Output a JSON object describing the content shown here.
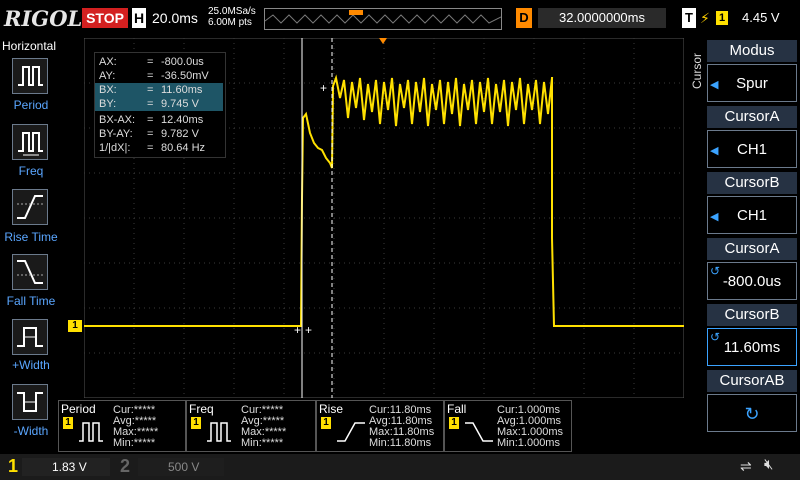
{
  "header": {
    "logo": "RIGOL",
    "run_state": "STOP",
    "h_label": "H",
    "timebase": "20.0ms",
    "sample_rate": "25.0MSa/s",
    "mem_depth": "6.00M pts",
    "d_label": "D",
    "delay": "32.0000000ms",
    "t_label": "T",
    "trigger_slope_icon": "rising-edge-icon",
    "trigger_channel": "1",
    "trigger_level": "4.45 V"
  },
  "left_menu": {
    "title": "Horizontal",
    "items": [
      {
        "label": "Period",
        "icon": "period-measure-icon"
      },
      {
        "label": "Freq",
        "icon": "freq-measure-icon"
      },
      {
        "label": "Rise Time",
        "icon": "rise-time-icon"
      },
      {
        "label": "Fall Time",
        "icon": "fall-time-icon"
      },
      {
        "label": "+Width",
        "icon": "pos-width-icon"
      },
      {
        "label": "-Width",
        "icon": "neg-width-icon"
      }
    ]
  },
  "cursor_readout": [
    {
      "key": "AX:",
      "value": "-800.0us"
    },
    {
      "key": "AY:",
      "value": "-36.50mV"
    },
    {
      "key": "BX:",
      "value": "11.60ms"
    },
    {
      "key": "BY:",
      "value": "9.745 V"
    },
    {
      "key": "BX-AX:",
      "value": "12.40ms"
    },
    {
      "key": "BY-AY:",
      "value": "9.782 V"
    },
    {
      "key": "1/|dX|:",
      "value": "80.64 Hz"
    }
  ],
  "right_menu": {
    "side_label": "Cursor",
    "items": [
      {
        "title": "Modus",
        "value": "Spur"
      },
      {
        "title": "CursorA",
        "value": "CH1"
      },
      {
        "title": "CursorB",
        "value": "CH1"
      },
      {
        "title": "CursorA",
        "value": "-800.0us"
      },
      {
        "title": "CursorB",
        "value": "11.60ms"
      },
      {
        "title": "CursorAB",
        "value": ""
      }
    ]
  },
  "measurements": [
    {
      "title": "Period",
      "cur": "Cur:*****",
      "avg": "Avg:*****",
      "max": "Max:*****",
      "min": "Min:*****"
    },
    {
      "title": "Freq",
      "cur": "Cur:*****",
      "avg": "Avg:*****",
      "max": "Max:*****",
      "min": "Min:*****"
    },
    {
      "title": "Rise",
      "cur": "Cur:11.80ms",
      "avg": "Avg:11.80ms",
      "max": "Max:11.80ms",
      "min": "Min:11.80ms"
    },
    {
      "title": "Fall",
      "cur": "Cur:1.000ms",
      "avg": "Avg:1.000ms",
      "max": "Max:1.000ms",
      "min": "Min:1.000ms"
    }
  ],
  "channel_badge": "1",
  "channels": [
    {
      "num": "1",
      "scale": "1.83 V"
    },
    {
      "num": "2",
      "scale": "500 V"
    }
  ],
  "colors": {
    "trace": "#ffe000",
    "accent_blue": "#3ba3ff",
    "stop": "#d32020",
    "delay": "#ff8a00"
  }
}
